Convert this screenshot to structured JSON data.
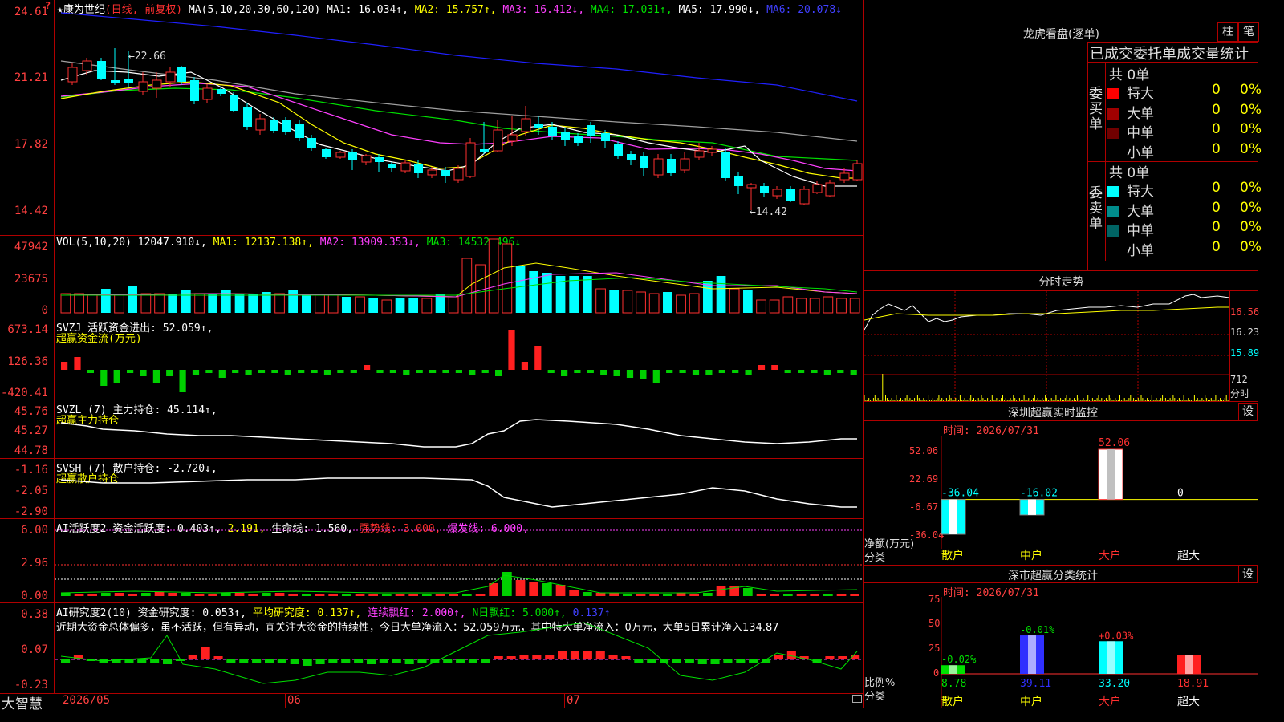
{
  "colors": {
    "up": "#ff3030",
    "down": "#00ffff",
    "ma_white": "#ffffff",
    "ma_yellow": "#ffff00",
    "ma_magenta": "#ff40ff",
    "ma_green": "#00e000",
    "ma_gray": "#a0a0a0",
    "ma_blue": "#2020ff",
    "grid": "#b00000"
  },
  "header": {
    "icon_q": "?",
    "title": "★康为世纪",
    "mode": "(日线, 前复权)",
    "ma_label": "MA(5,10,20,30,60,120)",
    "ma1": "MA1: 16.034↑,",
    "ma2": "MA2: 15.757↑,",
    "ma3": "MA3: 16.412↓,",
    "ma4": "MA4: 17.031↑,",
    "ma5": "MA5: 17.990↓,",
    "ma6": "MA6: 20.078↓"
  },
  "price_axis": [
    "24.61",
    "21.21",
    "17.82",
    "14.42"
  ],
  "price_annotations": {
    "high": "←22.66",
    "low": "←14.42"
  },
  "vol": {
    "label": "VOL(5,10,20)",
    "value": "12047.910↓,",
    "ma1": "MA1: 12137.138↑,",
    "ma2": "MA2: 13909.353↓,",
    "ma3": "MA3: 14532.496↓",
    "axis": [
      "47942",
      "23675",
      "0"
    ]
  },
  "svzj": {
    "label": "SVZJ  活跃资金进出: 52.059↑,",
    "sub": "超赢资金流(万元)",
    "axis": [
      "673.14",
      "126.36",
      "-420.41"
    ]
  },
  "svzl": {
    "label": "SVZL (7) 主力持仓: 45.114↑,",
    "sub": "超赢主力持仓",
    "axis": [
      "45.76",
      "45.27",
      "44.78"
    ]
  },
  "svsh": {
    "label": "SVSH (7) 散户持仓: -2.720↓,",
    "sub": "超赢散户持仓",
    "axis": [
      "-1.16",
      "-2.05",
      "-2.90"
    ]
  },
  "ai1": {
    "label": "AI活跃度2",
    "v1": "资金活跃度: 0.403↑,",
    "v2": "2.191,",
    "v3": "生命线: 1.560,",
    "v4": "强势线: 3.000,",
    "v5": "爆发线: 6.000,",
    "axis": [
      "6.00",
      "2.96",
      "0.00"
    ]
  },
  "ai2": {
    "label": "AI研究度2(10)",
    "v1": "资金研究度: 0.053↑,",
    "v2": "平均研究度: 0.137↑,",
    "v3": "连续飘红: 2.000↑,",
    "v4": "N日飘红: 5.000↑,",
    "v5": "0.137↑",
    "comment": "近期大资金总体偏多，虽不活跃，但有异动，宜关注大资金的持续性，今日大单净流入：52.059万元，其中特大单净流入：0万元，大单5日累计净入134.87",
    "axis": [
      "0.38",
      "0.07",
      "-0.23"
    ]
  },
  "xaxis": {
    "brand": "大智慧",
    "d1": "2026/05",
    "d2": "06",
    "d3": "07"
  },
  "dragon": {
    "title": "龙虎看盘(逐单)",
    "btn1": "柱",
    "btn2": "笔",
    "subtitle": "已成交委托单成交量统计",
    "buy": {
      "side": "委买单",
      "total": "共 0单",
      "rows": [
        {
          "name": "特大",
          "n": "0",
          "p": "0%",
          "color": "#ff0000"
        },
        {
          "name": "大单",
          "n": "0",
          "p": "0%",
          "color": "#a00000"
        },
        {
          "name": "中单",
          "n": "0",
          "p": "0%",
          "color": "#700000"
        },
        {
          "name": "小单",
          "n": "0",
          "p": "0%",
          "color": "#000000"
        }
      ]
    },
    "sell": {
      "side": "委卖单",
      "total": "共 0单",
      "rows": [
        {
          "name": "特大",
          "n": "0",
          "p": "0%",
          "color": "#00ffff"
        },
        {
          "name": "大单",
          "n": "0",
          "p": "0%",
          "color": "#008c8c"
        },
        {
          "name": "中单",
          "n": "0",
          "p": "0%",
          "color": "#006464"
        },
        {
          "name": "小单",
          "n": "0",
          "p": "0%",
          "color": "#000000"
        }
      ]
    }
  },
  "intraday": {
    "title": "分时走势",
    "axis": [
      "16.56",
      "16.23",
      "15.89"
    ],
    "vol": "712",
    "vol_label": "分时"
  },
  "monitor": {
    "title": "深圳超赢实时监控",
    "btn": "设",
    "time": "时间: 2026/07/31",
    "axis": [
      "52.06",
      "22.69",
      "-6.67",
      "-36.04"
    ],
    "unit1": "净额(万元)",
    "unit2": "分类",
    "categories": [
      "散户",
      "中户",
      "大户",
      "超大"
    ],
    "values": [
      -36.04,
      -16.02,
      52.06,
      0
    ],
    "value_labels": [
      "-36.04",
      "-16.02",
      "52.06",
      "0"
    ]
  },
  "stats": {
    "title": "深市超赢分类统计",
    "btn": "设",
    "time": "时间: 2026/07/31",
    "axis": [
      "75",
      "50",
      "25",
      "0"
    ],
    "unit1": "比例%",
    "unit2": "分类",
    "categories": [
      "散户",
      "中户",
      "大户",
      "超大"
    ],
    "values": [
      8.78,
      39.11,
      33.2,
      18.91
    ],
    "value_labels": [
      "8.78",
      "39.11",
      "33.20",
      "18.91"
    ],
    "changes": [
      "-0.02%",
      "-0.01%",
      "+0.03%",
      ""
    ]
  }
}
